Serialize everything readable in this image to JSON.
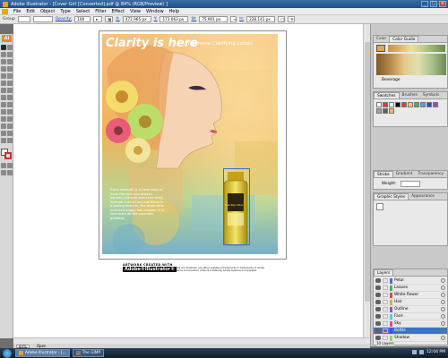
{
  "window": {
    "title": "Adobe Illustrator - [Cover Girl [Converted].pdf @ 84% (RGB/Preview) ]"
  },
  "menu": [
    "File",
    "Edit",
    "Object",
    "Type",
    "Select",
    "Filter",
    "Effect",
    "View",
    "Window",
    "Help"
  ],
  "control_bar": {
    "selection": "Group",
    "opacity_label": "Opacity:",
    "opacity_value": "100",
    "x_label": "X:",
    "x_value": "471.965 px",
    "y_label": "Y:",
    "y_value": "173.063 px",
    "w_label": "W:",
    "w_value": "75.901 px",
    "h_label": "H:",
    "h_value": "228.141 px"
  },
  "artwork": {
    "headline": "Clarity is here",
    "subheadline": "Intensive Clarifying Lotion",
    "body": "Extra strength is a fresh step to have the skin you always wanted. Ultra oil-free pure fresh formula cuts oil and clarifying in a lasting formula, the more time and technology has allowed it to formulate all the cosmetic qualities.",
    "bottle_label": "Dual Ray Lotion"
  },
  "credits": {
    "tag": "ARTWORK CREATED WITH",
    "brand": "Adobe®Illustrator®",
    "fine": "Adobe and Illustrator are either registered trademarks or trademarks of Adobe Systems Incorporated. Artwork created by Adobe Systems Incorporated."
  },
  "status": {
    "zoom": "84%",
    "mode": "Open"
  },
  "panels": {
    "color_tabs": [
      "Color",
      "Color Guide"
    ],
    "color_footer": "Beverage",
    "swatch_tabs": [
      "Swatches",
      "Brushes",
      "Symbols"
    ],
    "stroke_tabs": [
      "Stroke",
      "Gradient",
      "Transparency"
    ],
    "stroke_weight_label": "Weight:",
    "graphic_tabs": [
      "Graphic Styles",
      "Appearance"
    ],
    "layers_tab": "Layers",
    "layers": [
      "Petal",
      "Leaves",
      "White flower",
      "Hair",
      "Outline",
      "Face",
      "Sky",
      "Bottle",
      "Shadow"
    ],
    "layers_count": "10 Layers"
  },
  "layer_colors": [
    "#4a6fd6",
    "#4ab54a",
    "#e24a4a",
    "#d6a94a",
    "#a34ad6",
    "#4ad6d6",
    "#d64aa3",
    "#4a4ad6",
    "#96d64a"
  ],
  "taskbar": {
    "items": [
      "Adobe Illustrator - [...",
      "The GIMP"
    ],
    "clock": "12:04 PM"
  }
}
